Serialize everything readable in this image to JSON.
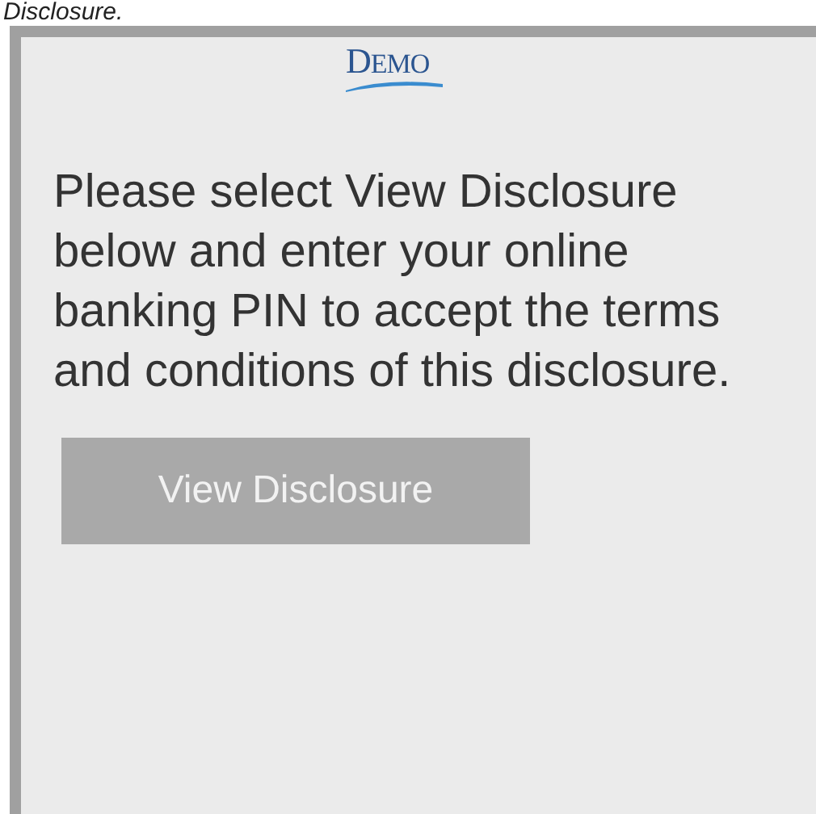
{
  "caption": "Disclosure.",
  "logo": {
    "text": "DEMO"
  },
  "message": "Please select View Disclosure below and enter your online banking PIN to accept the terms and conditions of this disclosure.",
  "button": {
    "label": "View Disclosure",
    "disabled": true
  }
}
